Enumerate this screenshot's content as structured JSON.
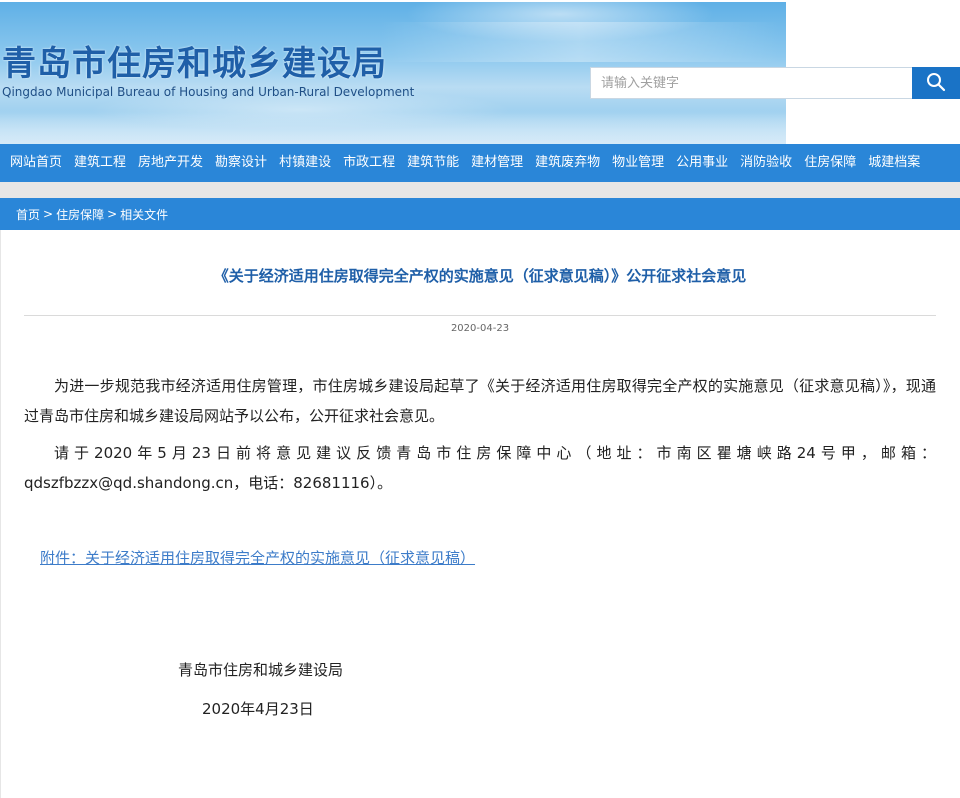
{
  "header": {
    "title": "青岛市住房和城乡建设局",
    "subtitle": "Qingdao Municipal Bureau of Housing and Urban-Rural Development",
    "search": {
      "placeholder": "请输入关键字",
      "value": "",
      "button_icon": "search-icon"
    }
  },
  "nav": {
    "items": [
      {
        "label": "网站首页"
      },
      {
        "label": "建筑工程"
      },
      {
        "label": "房地产开发"
      },
      {
        "label": "勘察设计"
      },
      {
        "label": "村镇建设"
      },
      {
        "label": "市政工程"
      },
      {
        "label": "建筑节能"
      },
      {
        "label": "建材管理"
      },
      {
        "label": "建筑废弃物"
      },
      {
        "label": "物业管理"
      },
      {
        "label": "公用事业"
      },
      {
        "label": "消防验收"
      },
      {
        "label": "住房保障"
      },
      {
        "label": "城建档案"
      }
    ]
  },
  "breadcrumb": {
    "home": "首页",
    "section": "住房保障",
    "current": "相关文件",
    "separator": ">"
  },
  "article": {
    "title": "《关于经济适用住房取得完全产权的实施意见（征求意见稿）》公开征求社会意见",
    "date": "2020-04-23",
    "paragraph1": "为进一步规范我市经济适用住房管理，市住房城乡建设局起草了《关于经济适用住房取得完全产权的实施意见（征求意见稿）》，现通过青岛市住房和城乡建设局网站予以公布，公开征求社会意见。",
    "paragraph2": "请于2020年5月23日前将意见建议反馈青岛市住房保障中心（地址：市南区瞿塘峡路24号甲，邮箱：qdszfbzzx@qd.shandong.cn，电话：82681116）。",
    "attachment": "附件：关于经济适用住房取得完全产权的实施意见（征求意见稿）",
    "signature_org": "青岛市住房和城乡建设局",
    "signature_date": "2020年4月23日"
  },
  "colors": {
    "nav_bg": "#2a86d8",
    "title_blue": "#1f5fa8",
    "link_blue": "#3d7cc9",
    "search_button": "#1a73c6"
  }
}
